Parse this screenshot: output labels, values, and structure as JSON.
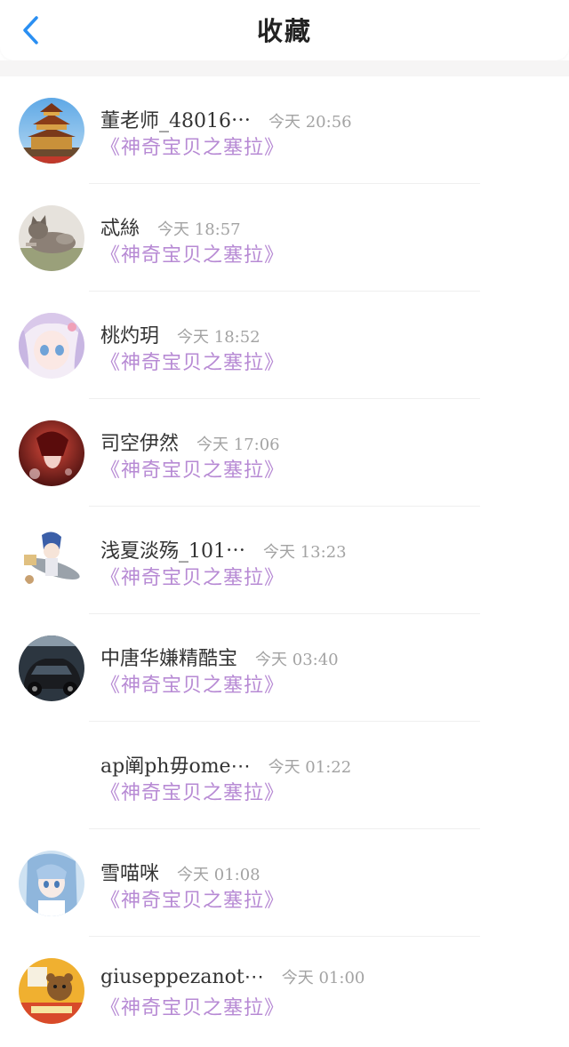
{
  "header": {
    "title": "收藏",
    "back_icon": "chevron-left-icon",
    "accent_color": "#2a8ff2"
  },
  "items": [
    {
      "name": "董老师_48016⋯",
      "time": "今天 20:56",
      "book": "《神奇宝贝之塞拉》",
      "avatar": "tower"
    },
    {
      "name": "忒絲",
      "time": "今天 18:57",
      "book": "《神奇宝贝之塞拉》",
      "avatar": "cat"
    },
    {
      "name": "桃灼玥",
      "time": "今天 18:52",
      "book": "《神奇宝贝之塞拉》",
      "avatar": "anime-girl"
    },
    {
      "name": "司空伊然",
      "time": "今天 17:06",
      "book": "《神奇宝贝之塞拉》",
      "avatar": "red"
    },
    {
      "name": "浅夏淡殇_101⋯",
      "time": "今天 13:23",
      "book": "《神奇宝贝之塞拉》",
      "avatar": "fish-boy"
    },
    {
      "name": "中唐华嫌精酷宝",
      "time": "今天 03:40",
      "book": "《神奇宝贝之塞拉》",
      "avatar": "car"
    },
    {
      "name": "ap阐ph毋ome⋯",
      "time": "今天 01:22",
      "book": "《神奇宝贝之塞拉》",
      "avatar": "none"
    },
    {
      "name": "雪喵咪",
      "time": "今天 01:08",
      "book": "《神奇宝贝之塞拉》",
      "avatar": "blue-girl"
    },
    {
      "name": "giuseppezanot⋯",
      "time": "今天 01:00",
      "book": "《神奇宝贝之塞拉》",
      "avatar": "bear"
    }
  ],
  "colors": {
    "book_link": "#b78ad4",
    "time": "#a3a3a3",
    "name": "#333333"
  }
}
